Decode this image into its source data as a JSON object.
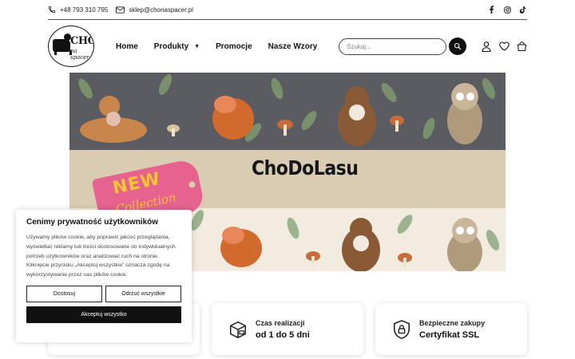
{
  "topbar": {
    "phone": "+48 793 310 795",
    "email": "sklep@chonaspacer.pl",
    "social": [
      "facebook-icon",
      "instagram-icon",
      "tiktok-icon"
    ]
  },
  "logo": {
    "line1": "CHO-",
    "line2": "na spacer"
  },
  "nav": {
    "items": [
      {
        "label": "Home"
      },
      {
        "label": "Produkty",
        "has_dropdown": true
      },
      {
        "label": "Promocje"
      },
      {
        "label": "Nasze Wzory"
      }
    ]
  },
  "search": {
    "placeholder": "Szukaj..."
  },
  "header_icons": [
    "user-icon",
    "heart-icon",
    "cart-icon"
  ],
  "banner": {
    "title": "ChoDoLasu",
    "tag_line1": "NEW",
    "tag_line2": "Collection"
  },
  "cookie": {
    "title": "Cenimy prywatność użytkowników",
    "body": "Używamy plików cookie, aby poprawić jakość przeglądania, wyświetlać reklamy lub treści dostosowane do indywidualnych potrzeb użytkowników oraz analizować ruch na stronie. Kliknięcie przycisku „Akceptuj wszystkie” oznacza zgodę na wykorzystywanie przez nas plików cookie.",
    "customize": "Dostosuj",
    "reject": "Odrzuć wszystkie",
    "accept": "Akceptuj wszystko"
  },
  "features": [
    {
      "icon": "truck-icon",
      "line1": "",
      "line2": ""
    },
    {
      "icon": "box-icon",
      "line1": "Czas realizacji",
      "line2": "od 1 do 5 dni"
    },
    {
      "icon": "shield-lock-icon",
      "line1": "Bezpieczne zakupy",
      "line2": "Certyfikat SSL"
    }
  ],
  "colors": {
    "accent": "#111111",
    "banner_top": "#5a5c61",
    "banner_mid": "#d9ccb2",
    "banner_bottom": "#f2ece0",
    "tag_pink": "#e7638f",
    "tag_yellow": "#f4c431"
  }
}
